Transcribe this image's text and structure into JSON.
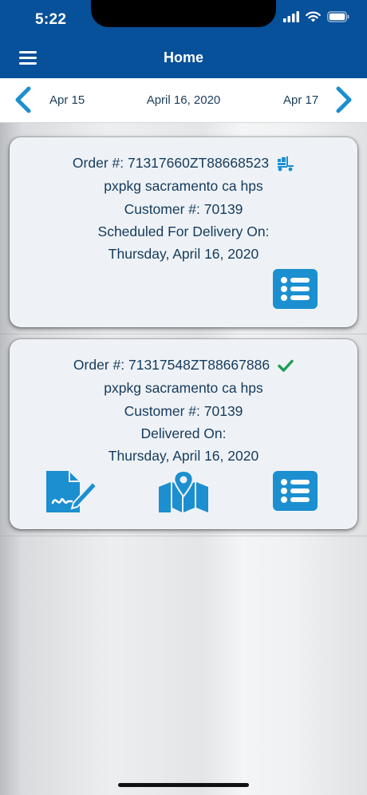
{
  "status_bar": {
    "time": "5:22"
  },
  "header": {
    "title": "Home",
    "menu_icon": "hamburger-menu-icon"
  },
  "date_nav": {
    "prev": "Apr 15",
    "current": "April 16, 2020",
    "next": "Apr 17"
  },
  "colors": {
    "brand_blue": "#07509a",
    "icon_blue": "#1b8fd0",
    "check_green": "#1f9d55"
  },
  "orders": [
    {
      "order_label": "Order #: 71317660ZT88668523",
      "status_icon": "delivery-truck-icon",
      "location": "pxpkg sacramento ca hps",
      "customer": "Customer #: 70139",
      "status_text": "Scheduled For Delivery On:",
      "date": "Thursday, April 16, 2020",
      "actions": [
        "details-list-icon"
      ]
    },
    {
      "order_label": "Order #: 71317548ZT88667886",
      "status_icon": "check-icon",
      "location": "pxpkg sacramento ca hps",
      "customer": "Customer #: 70139",
      "status_text": "Delivered On:",
      "date": "Thursday, April 16, 2020",
      "actions": [
        "signature-icon",
        "map-icon",
        "details-list-icon"
      ]
    }
  ]
}
